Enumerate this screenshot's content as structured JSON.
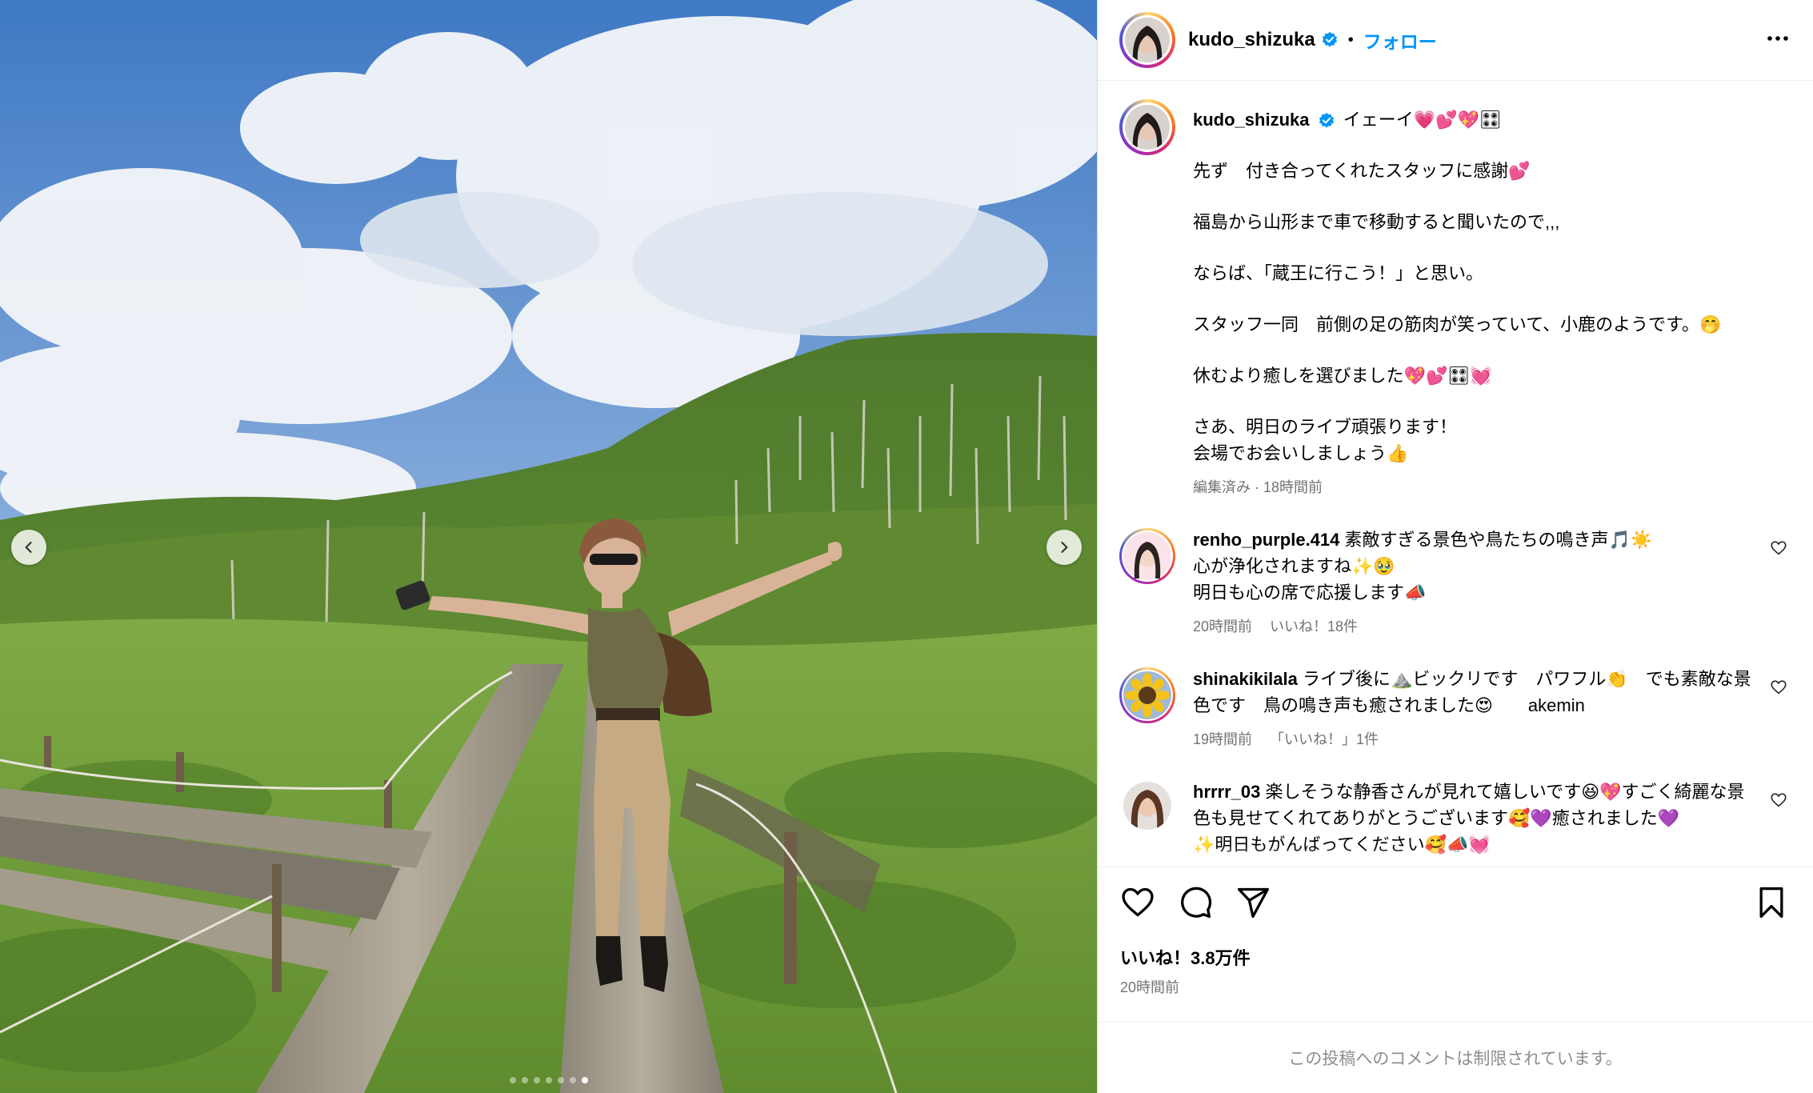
{
  "post": {
    "username": "kudo_shizuka",
    "separator": "•",
    "follow_label": "フォロー",
    "caption_lead": "イェーイ💗💕💖🎛",
    "caption_lines": [
      "先ず　付き合ってくれたスタッフに感謝💕",
      "福島から山形まで車で移動すると聞いたので,,,",
      "ならば、「蔵王に行こう！」と思い。",
      "スタッフ一同　前側の足の筋肉が笑っていて、小鹿のようです。🤭",
      "休むより癒しを選びました💖💕🎛💓",
      "さあ、明日のライブ頑張ります！",
      "会場でお会いしましょう👍"
    ],
    "caption_meta": "編集済み · 18時間前"
  },
  "comments": [
    {
      "username": "renho_purple.414",
      "text_first": "素敵すぎる景色や鳥たちの鳴き声🎵☀️",
      "text_rest": [
        "心が浄化されますね✨🥹",
        "明日も心の席で応援します📣"
      ],
      "time": "20時間前",
      "likes": "いいね！18件"
    },
    {
      "username": "shinakikilala",
      "text_first": "ライブ後に⛰️ビックリです　パワフル👏　でも素敵な景色です　鳥の鳴き声も癒されました😍　　akemin",
      "text_rest": [],
      "time": "19時間前",
      "likes": "「いいね！」1件"
    },
    {
      "username": "hrrrr_03",
      "text_first": "楽しそうな静香さんが見れて嬉しいです😆💖すごく綺麗な景色も見せてくれてありがとうございます🥰💜癒されました💜",
      "text_rest": [
        "✨明日もがんばってください🥰📣💓"
      ],
      "time": "",
      "likes": ""
    }
  ],
  "actions": {
    "likes_label": "いいね！3.8万件",
    "time": "20時間前",
    "comments_restricted": "この投稿へのコメントは制限されています。"
  },
  "icons": {
    "prev": "chevron-left-icon",
    "next": "chevron-right-icon",
    "verified": "verified-badge-icon",
    "more": "more-options-icon",
    "like": "heart-icon",
    "comment": "comment-icon",
    "share": "share-icon",
    "save": "bookmark-icon"
  },
  "colors": {
    "link": "#0095f6",
    "meta": "#737373",
    "verified": "#0095f6"
  },
  "carousel": {
    "slide_count": 7,
    "active_slide": 6
  }
}
